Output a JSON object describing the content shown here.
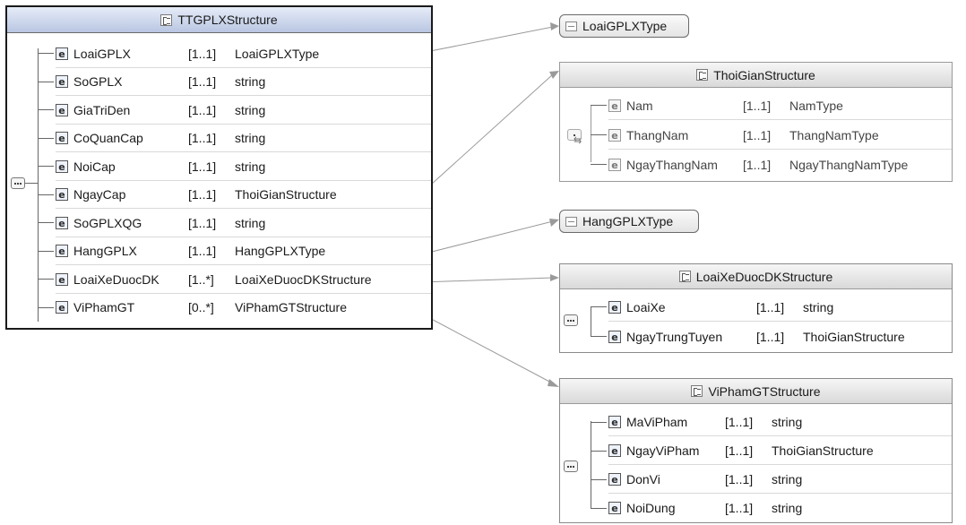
{
  "ttgplx": {
    "title": "TTGPLXStructure",
    "rows": [
      {
        "name": "LoaiGPLX",
        "card": "[1..1]",
        "type": "LoaiGPLXType"
      },
      {
        "name": "SoGPLX",
        "card": "[1..1]",
        "type": "string"
      },
      {
        "name": "GiaTriDen",
        "card": "[1..1]",
        "type": "string"
      },
      {
        "name": "CoQuanCap",
        "card": "[1..1]",
        "type": "string"
      },
      {
        "name": "NoiCap",
        "card": "[1..1]",
        "type": "string"
      },
      {
        "name": "NgayCap",
        "card": "[1..1]",
        "type": "ThoiGianStructure"
      },
      {
        "name": "SoGPLXQG",
        "card": "[1..1]",
        "type": "string"
      },
      {
        "name": "HangGPLX",
        "card": "[1..1]",
        "type": "HangGPLXType"
      },
      {
        "name": "LoaiXeDuocDK",
        "card": "[1..*]",
        "type": "LoaiXeDuocDKStructure"
      },
      {
        "name": "ViPhamGT",
        "card": "[0..*]",
        "type": "ViPhamGTStructure"
      }
    ]
  },
  "loaigplxtype": {
    "title": "LoaiGPLXType"
  },
  "thoigian": {
    "title": "ThoiGianStructure",
    "rows": [
      {
        "name": "Nam",
        "card": "[1..1]",
        "type": "NamType"
      },
      {
        "name": "ThangNam",
        "card": "[1..1]",
        "type": "ThangNamType"
      },
      {
        "name": "NgayThangNam",
        "card": "[1..1]",
        "type": "NgayThangNamType"
      }
    ]
  },
  "hanggplxtype": {
    "title": "HangGPLXType"
  },
  "loaixe": {
    "title": "LoaiXeDuocDKStructure",
    "rows": [
      {
        "name": "LoaiXe",
        "card": "[1..1]",
        "type": "string"
      },
      {
        "name": "NgayTrungTuyen",
        "card": "[1..1]",
        "type": "ThoiGianStructure"
      }
    ]
  },
  "vipham": {
    "title": "ViPhamGTStructure",
    "rows": [
      {
        "name": "MaViPham",
        "card": "[1..1]",
        "type": "string"
      },
      {
        "name": "NgayViPham",
        "card": "[1..1]",
        "type": "ThoiGianStructure"
      },
      {
        "name": "DonVi",
        "card": "[1..1]",
        "type": "string"
      },
      {
        "name": "NoiDung",
        "card": "[1..1]",
        "type": "string"
      }
    ]
  },
  "icons": {
    "element": "e",
    "sequence": "sequence-icon",
    "choice": "choice-icon",
    "complex_type": "complex-type-icon",
    "simple_type": "simple-type-icon"
  }
}
